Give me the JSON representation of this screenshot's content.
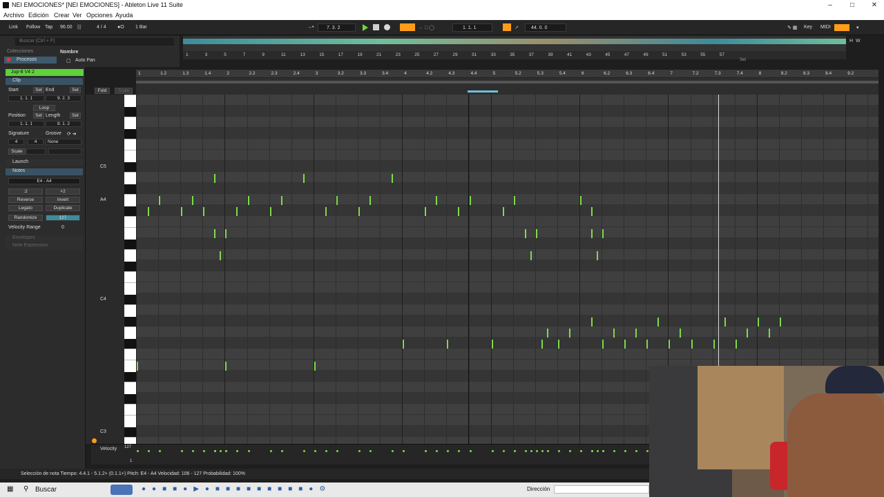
{
  "window": {
    "title": "NEI EMOCIONES*  [NEI EMOCIONES] - Ableton Live 11 Suite"
  },
  "menu": [
    "Archivo",
    "Edición",
    "Crear",
    "Ver",
    "Opciones",
    "Ayuda"
  ],
  "transport": {
    "link": "Link",
    "follow": "Follow",
    "tap": "Tap",
    "tempo": "96.00",
    "signature": "4 / 4",
    "quantize": "1 Bar",
    "position": "7.   3.   2",
    "loop_start": "1.   1.   1",
    "loop_length": "44.   0.   0",
    "key": "Key",
    "midi": "MIDI"
  },
  "browser": {
    "search_placeholder": "Buscar (Ctrl + F)",
    "collections": "Colecciones",
    "categories": "Procesos",
    "name_header": "Nombre",
    "item": "Auto Pan"
  },
  "overview": {
    "bars": [
      "1",
      "3",
      "5",
      "7",
      "9",
      "11",
      "13",
      "15",
      "17",
      "19",
      "21",
      "23",
      "25",
      "27",
      "29",
      "31",
      "33",
      "35",
      "37",
      "39",
      "41",
      "43",
      "45",
      "47",
      "49",
      "51",
      "53",
      "55",
      "57"
    ],
    "set_label": "Set"
  },
  "clip_panel": {
    "clip_name": "Jup-8 V4 2",
    "clip_tab": "Clip",
    "start_label": "Start",
    "end_label": "End",
    "set_label": "Set",
    "start_value": "1.   1.   1",
    "end_value": "9.   2.   3",
    "loop_label": "Loop",
    "position_label": "Position",
    "length_label": "Length",
    "position_value": "1.   1.   1",
    "length_value": "8.   1.   2",
    "signature_label": "Signature",
    "groove_label": "Groove",
    "sig_num": "4",
    "sig_den": "4",
    "groove_value": "None",
    "scale_label": "Scale",
    "launch_label": "Launch",
    "notes_label": "Notes",
    "note_range": "E4 - A4",
    "half": ":2",
    "double": "×2",
    "reverse": "Reverse",
    "invert": "Invert",
    "legato": "Legato",
    "duplicate": "Duplicate",
    "randomize": "Randomize",
    "randomize_value": "127",
    "velocity_range_label": "Velocity Range",
    "velocity_range_value": "0",
    "envelopes": "Envelopes",
    "note_expression": "Note Expression"
  },
  "editor": {
    "fold": "Fold",
    "scale": "Scale",
    "ruler": [
      "1",
      "1.2",
      "1.3",
      "1.4",
      "2",
      "2.2",
      "2.3",
      "2.4",
      "3",
      "3.2",
      "3.3",
      "3.4",
      "4",
      "4.2",
      "4.3",
      "4.4",
      "5",
      "5.2",
      "5.3",
      "5.4",
      "6",
      "6.2",
      "6.3",
      "6.4",
      "7",
      "7.2",
      "7.3",
      "7.4",
      "8",
      "8.2",
      "8.3",
      "8.4",
      "9.2"
    ],
    "key_labels": [
      "C5",
      "A4",
      "C4",
      "C3"
    ],
    "velocity_label": "Velocity",
    "velocity_max": "127",
    "velocity_min": "1"
  },
  "notes": [
    {
      "beat": 0.0,
      "row": 24
    },
    {
      "beat": 0.5,
      "row": 10
    },
    {
      "beat": 1.0,
      "row": 9
    },
    {
      "beat": 2.0,
      "row": 10
    },
    {
      "beat": 2.5,
      "row": 9
    },
    {
      "beat": 3.0,
      "row": 10
    },
    {
      "beat": 3.5,
      "row": 7
    },
    {
      "beat": 3.5,
      "row": 12
    },
    {
      "beat": 3.75,
      "row": 14
    },
    {
      "beat": 4.0,
      "row": 12
    },
    {
      "beat": 4.0,
      "row": 24
    },
    {
      "beat": 4.5,
      "row": 10
    },
    {
      "beat": 5.0,
      "row": 9
    },
    {
      "beat": 6.0,
      "row": 10
    },
    {
      "beat": 6.5,
      "row": 9
    },
    {
      "beat": 7.5,
      "row": 7
    },
    {
      "beat": 8.0,
      "row": 24
    },
    {
      "beat": 8.5,
      "row": 10
    },
    {
      "beat": 9.0,
      "row": 9
    },
    {
      "beat": 10.0,
      "row": 10
    },
    {
      "beat": 10.5,
      "row": 9
    },
    {
      "beat": 11.5,
      "row": 7
    },
    {
      "beat": 12.0,
      "row": 22
    },
    {
      "beat": 13.0,
      "row": 10
    },
    {
      "beat": 13.5,
      "row": 9
    },
    {
      "beat": 14.0,
      "row": 22
    },
    {
      "beat": 14.5,
      "row": 10
    },
    {
      "beat": 15.0,
      "row": 9
    },
    {
      "beat": 16.0,
      "row": 22
    },
    {
      "beat": 16.5,
      "row": 10
    },
    {
      "beat": 17.0,
      "row": 9
    },
    {
      "beat": 17.5,
      "row": 12
    },
    {
      "beat": 17.75,
      "row": 14
    },
    {
      "beat": 18.0,
      "row": 12
    },
    {
      "beat": 18.25,
      "row": 22
    },
    {
      "beat": 18.5,
      "row": 21
    },
    {
      "beat": 19.0,
      "row": 22
    },
    {
      "beat": 19.5,
      "row": 21
    },
    {
      "beat": 20.0,
      "row": 9
    },
    {
      "beat": 20.5,
      "row": 10
    },
    {
      "beat": 20.5,
      "row": 12
    },
    {
      "beat": 20.5,
      "row": 20
    },
    {
      "beat": 20.75,
      "row": 14
    },
    {
      "beat": 21.0,
      "row": 12
    },
    {
      "beat": 21.0,
      "row": 22
    },
    {
      "beat": 21.5,
      "row": 21
    },
    {
      "beat": 22.0,
      "row": 22
    },
    {
      "beat": 22.5,
      "row": 21
    },
    {
      "beat": 23.0,
      "row": 22
    },
    {
      "beat": 23.5,
      "row": 20
    },
    {
      "beat": 24.0,
      "row": 22
    },
    {
      "beat": 24.5,
      "row": 21
    },
    {
      "beat": 25.0,
      "row": 22
    },
    {
      "beat": 26.0,
      "row": 22
    },
    {
      "beat": 26.5,
      "row": 20
    },
    {
      "beat": 27.0,
      "row": 22
    },
    {
      "beat": 27.5,
      "row": 21
    },
    {
      "beat": 28.0,
      "row": 20
    },
    {
      "beat": 28.5,
      "row": 21
    },
    {
      "beat": 29.0,
      "row": 20
    }
  ],
  "status": {
    "text": "Selección de nota    Tiempo: 4.4.1 - 5.1.2+ (0.1.1+)    Pitch: E4 - A4    Velocidad: 106 - 127    Probabilidad: 100%"
  },
  "taskbar": {
    "search": "Buscar",
    "address_label": "Dirección"
  },
  "colors": {
    "accent": "#ff9c1a",
    "note": "#7fdc4a",
    "clip": "#5ed23b",
    "teal": "#3c8c9c"
  }
}
